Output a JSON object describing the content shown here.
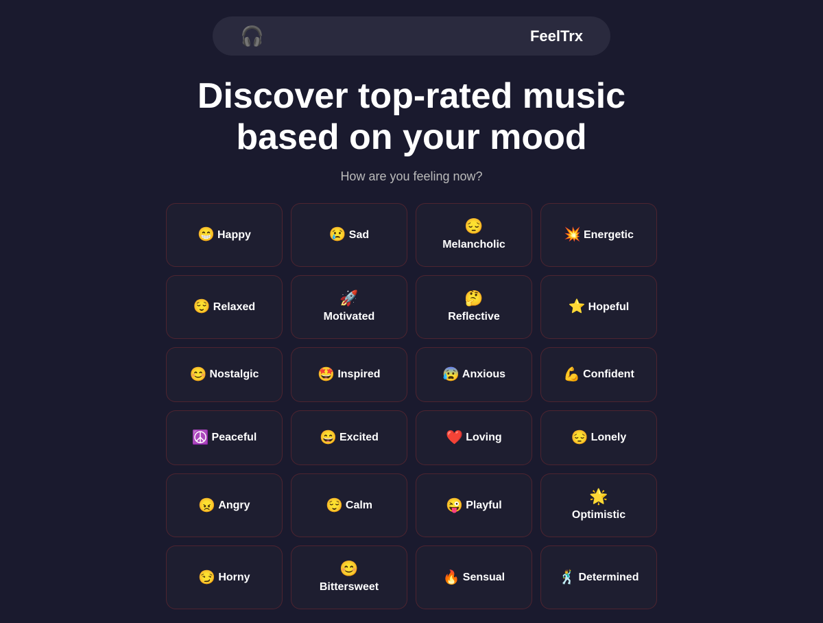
{
  "header": {
    "logo_icon": "🎧",
    "logo_text": "FeelTrx"
  },
  "hero": {
    "title": "Discover top-rated music based on your mood",
    "subtitle": "How are you feeling now?"
  },
  "moods": [
    {
      "emoji": "😁",
      "label": "Happy",
      "inline": true
    },
    {
      "emoji": "😢",
      "label": "Sad",
      "inline": true
    },
    {
      "emoji": "😔",
      "label": "Melancholic",
      "inline": false
    },
    {
      "emoji": "💥",
      "label": "Energetic",
      "inline": true
    },
    {
      "emoji": "😌",
      "label": "Relaxed",
      "inline": true
    },
    {
      "emoji": "🚀",
      "label": "Motivated",
      "inline": false
    },
    {
      "emoji": "🤔",
      "label": "Reflective",
      "inline": false
    },
    {
      "emoji": "⭐",
      "label": "Hopeful",
      "inline": true
    },
    {
      "emoji": "😊",
      "label": "Nostalgic",
      "inline": true
    },
    {
      "emoji": "🤩",
      "label": "Inspired",
      "inline": true
    },
    {
      "emoji": "😰",
      "label": "Anxious",
      "inline": true
    },
    {
      "emoji": "💪",
      "label": "Confident",
      "inline": true
    },
    {
      "emoji": "☮️",
      "label": "Peaceful",
      "inline": true
    },
    {
      "emoji": "😄",
      "label": "Excited",
      "inline": true
    },
    {
      "emoji": "❤️",
      "label": "Loving",
      "inline": true
    },
    {
      "emoji": "😔",
      "label": "Lonely",
      "inline": true
    },
    {
      "emoji": "😠",
      "label": "Angry",
      "inline": true
    },
    {
      "emoji": "😌",
      "label": "Calm",
      "inline": true
    },
    {
      "emoji": "😜",
      "label": "Playful",
      "inline": true
    },
    {
      "emoji": "🌟",
      "label": "Optimistic",
      "inline": false
    },
    {
      "emoji": "😏",
      "label": "Horny",
      "inline": true
    },
    {
      "emoji": "😊",
      "label": "Bittersweet",
      "inline": false
    },
    {
      "emoji": "🔥",
      "label": "Sensual",
      "inline": true
    },
    {
      "emoji": "🕺",
      "label": "Determined",
      "inline": true
    }
  ]
}
